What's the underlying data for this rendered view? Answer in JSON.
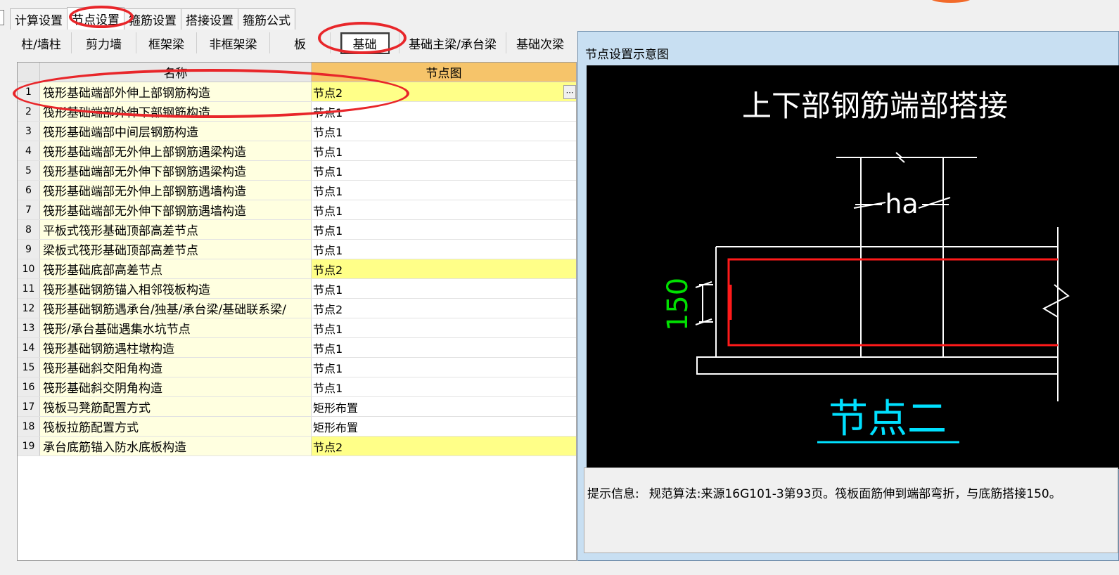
{
  "top_tabs": [
    "计算设置",
    "节点设置",
    "箍筋设置",
    "搭接设置",
    "箍筋公式"
  ],
  "sub_tabs": [
    "柱/墙柱",
    "剪力墙",
    "框架梁",
    "非框架梁",
    "板",
    "基础",
    "基础主梁/承台梁",
    "基础次梁"
  ],
  "grid": {
    "headers": [
      "名称",
      "节点图"
    ],
    "rows": [
      {
        "num": "1",
        "name": "筏形基础端部外伸上部钢筋构造",
        "node": "节点2",
        "highlight": true
      },
      {
        "num": "2",
        "name": "筏形基础端部外伸下部钢筋构造",
        "node": "节点1",
        "highlight": false
      },
      {
        "num": "3",
        "name": "筏形基础端部中间层钢筋构造",
        "node": "节点1",
        "highlight": false
      },
      {
        "num": "4",
        "name": "筏形基础端部无外伸上部钢筋遇梁构造",
        "node": "节点1",
        "highlight": false
      },
      {
        "num": "5",
        "name": "筏形基础端部无外伸下部钢筋遇梁构造",
        "node": "节点1",
        "highlight": false
      },
      {
        "num": "6",
        "name": "筏形基础端部无外伸上部钢筋遇墙构造",
        "node": "节点1",
        "highlight": false
      },
      {
        "num": "7",
        "name": "筏形基础端部无外伸下部钢筋遇墙构造",
        "node": "节点1",
        "highlight": false
      },
      {
        "num": "8",
        "name": "平板式筏形基础顶部高差节点",
        "node": "节点1",
        "highlight": false
      },
      {
        "num": "9",
        "name": "梁板式筏形基础顶部高差节点",
        "node": "节点1",
        "highlight": false
      },
      {
        "num": "10",
        "name": "筏形基础底部高差节点",
        "node": "节点2",
        "highlight": true
      },
      {
        "num": "11",
        "name": "筏形基础钢筋锚入相邻筏板构造",
        "node": "节点1",
        "highlight": false
      },
      {
        "num": "12",
        "name": "筏形基础钢筋遇承台/独基/承台梁/基础联系梁/",
        "node": "节点2",
        "highlight": false
      },
      {
        "num": "13",
        "name": "筏形/承台基础遇集水坑节点",
        "node": "节点1",
        "highlight": false
      },
      {
        "num": "14",
        "name": "筏形基础钢筋遇柱墩构造",
        "node": "节点1",
        "highlight": false
      },
      {
        "num": "15",
        "name": "筏形基础斜交阳角构造",
        "node": "节点1",
        "highlight": false
      },
      {
        "num": "16",
        "name": "筏形基础斜交阴角构造",
        "node": "节点1",
        "highlight": false
      },
      {
        "num": "17",
        "name": "筏板马凳筋配置方式",
        "node": "矩形布置",
        "highlight": false
      },
      {
        "num": "18",
        "name": "筏板拉筋配置方式",
        "node": "矩形布置",
        "highlight": false
      },
      {
        "num": "19",
        "name": "承台底筋锚入防水底板构造",
        "node": "节点2",
        "highlight": true
      }
    ]
  },
  "panel": {
    "title": "节点设置示意图",
    "diagram_title": "上下部钢筋端部搭接",
    "dim_ha": "ha",
    "dim_150": "150",
    "node_caption": "节点二",
    "info_label": "提示信息:",
    "info_text": "规范算法:来源16G101-3第93页。筏板面筋伸到端部弯折，与底筋搭接150。"
  },
  "colors": {
    "annotation": "#e8262a",
    "header_node": "#f6c46a",
    "row_highlight": "#ffff88",
    "name_bg": "#ffffe0",
    "dim_green": "#00e000",
    "caption_cyan": "#00e0ff",
    "rebar_red": "#ff1a1a"
  }
}
